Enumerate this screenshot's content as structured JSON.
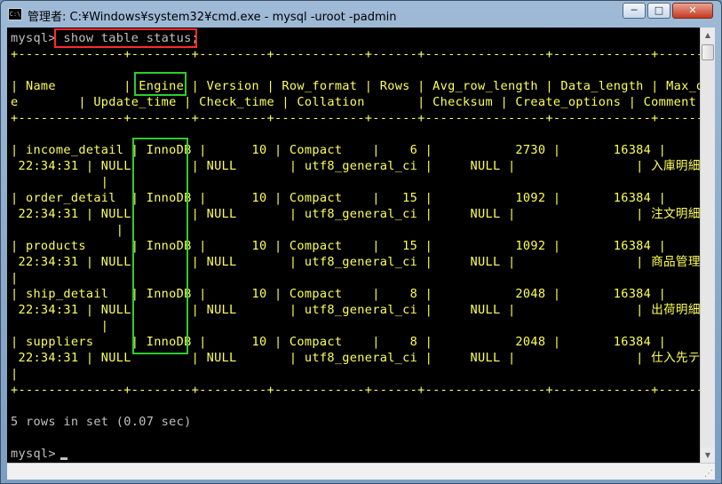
{
  "window": {
    "title": "管理者: C:¥Windows¥system32¥cmd.exe - mysql  -uroot -padmin",
    "icon": "cmd-icon",
    "icon_label": "C:\\",
    "minimize_label": "─",
    "maximize_label": "□",
    "close_label": "✕"
  },
  "console": {
    "prompt_cmd": {
      "prompt": "mysql> ",
      "command": "show table status;"
    },
    "separator": "+--------------+--------+---------+------------+------+----------------+-------------+-------------+",
    "header_line1": "| Name         | Engine | Version | Row_format | Rows | Avg_row_length | Data_length | Max_data_",
    "header_line2": "e        | Update_time | Check_time | Collation       | Checksum | Create_options | Comment",
    "rows": [
      {
        "line1": "| income_detail | InnoDB |      10 | Compact    |    6 |           2730 |       16384 |",
        "line2": " 22:34:31 | NULL        | NULL       | utf8_general_ci |     NULL |                | 入庫明細トラ",
        "line3": "            |"
      },
      {
        "line1": "| order_detail  | InnoDB |      10 | Compact    |   15 |           1092 |       16384 |",
        "line2": " 22:34:31 | NULL        | NULL       | utf8_general_ci |     NULL |                | 注文明細トラ",
        "line3": "              |"
      },
      {
        "line1": "| products      | InnoDB |      10 | Compact    |   15 |           1092 |       16384 |",
        "line2": " 22:34:31 | NULL        | NULL       | utf8_general_ci |     NULL |                | 商品管理テー",
        "line3": "|"
      },
      {
        "line1": "| ship_detail   | InnoDB |      10 | Compact    |    8 |           2048 |       16384 |",
        "line2": " 22:34:31 | NULL        | NULL       | utf8_general_ci |     NULL |                | 出荷明細トラ",
        "line3": "            |"
      },
      {
        "line1": "| suppliers     | InnoDB |      10 | Compact    |    8 |           2048 |       16384 |",
        "line2": " 22:34:31 | NULL        | NULL       | utf8_general_ci |     NULL |                | 仕入先テーブ",
        "line3": "|"
      }
    ],
    "result": "5 rows in set (0.07 sec)",
    "final_prompt": "mysql> "
  },
  "scrollbar": {
    "up_arrow": "▲",
    "down_arrow": "▼",
    "grip": "⋰"
  }
}
